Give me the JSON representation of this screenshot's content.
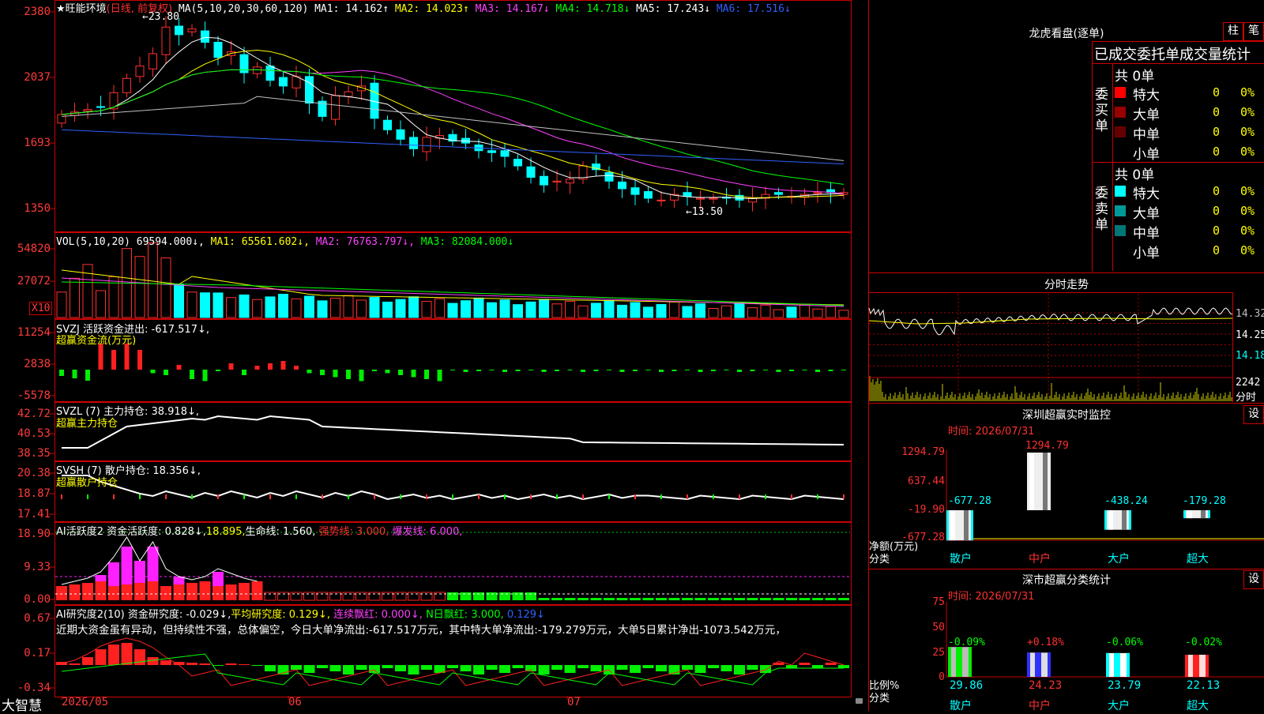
{
  "kline": {
    "title": "★旺能环境",
    "period": "(日线, 前复权)",
    "ma_label": "MA(5,10,20,30,60,120)",
    "ma1": "MA1: 14.162↑",
    "ma2": "MA2: 14.023↑",
    "ma3": "MA3: 14.167↓",
    "ma4": "MA4: 14.718↓",
    "ma5": "MA5: 17.243↓",
    "ma6": "MA6: 17.516↓",
    "y_labels": [
      "2380",
      "2037",
      "1693",
      "1350"
    ],
    "max_mark": "←23.80",
    "min_mark": "←13.50"
  },
  "vol": {
    "label": "VOL(5,10,20)",
    "value": "69594.000↓,",
    "ma1": "MA1: 65561.602↓,",
    "ma2": "MA2: 76763.797↓,",
    "ma3": "MA3: 82084.000↓",
    "y_labels": [
      "54820",
      "27072"
    ],
    "unit": "X10"
  },
  "svzj": {
    "label": "SVZJ  活跃资金进出: -617.517↓,",
    "sub": "超赢资金流(万元)",
    "y_labels": [
      "11254",
      "2838",
      "-5578"
    ]
  },
  "svzl": {
    "label": "SVZL (7) 主力持仓: 38.918↓,",
    "sub": "超赢主力持仓",
    "y_labels": [
      "42.72",
      "40.53",
      "38.35"
    ]
  },
  "svsh": {
    "label": "SVSH (7) 散户持仓: 18.356↓,",
    "sub": "超赢散户持仓",
    "y_labels": [
      "20.38",
      "18.87",
      "17.41"
    ]
  },
  "ai_active": {
    "label1": "AI活跃度2 资金活跃度: 0.828↓,",
    "value2": "18.895,",
    "label3": "生命线: 1.560,",
    "label4": "强势线: 3.000,",
    "label5": "爆发线: 6.000,",
    "y_labels": [
      "18.90",
      "9.33",
      "0.00"
    ]
  },
  "ai_research": {
    "label1": "AI研究度2(10) 资金研究度: -0.029↓,",
    "label2": "平均研究度: 0.129↓,",
    "label3": "连续飘红: 0.000↓,",
    "label4": "N日飘红: 3.000,",
    "label5": "0.129↓",
    "comment": "近期大资金虽有异动，但持续性不强，总体偏空，今日大单净流出:-617.517万元，其中特大单净流出:-179.279万元，大单5日累计净出-1073.542万元，",
    "y_labels": [
      "0.67",
      "0.17",
      "-0.34"
    ]
  },
  "xaxis": {
    "brand": "大智慧",
    "labels": [
      "2026/05",
      "06",
      "07"
    ]
  },
  "right": {
    "lhb_title": "龙虎看盘(逐单)",
    "btn1": "柱",
    "btn2": "笔",
    "table_title": "已成交委托单成交量统计",
    "buy_side_label": "委买单",
    "sell_side_label": "委卖单",
    "buy_total": "共 0单",
    "sell_total": "共 0单",
    "buy_rows": [
      {
        "name": "特大",
        "count": "0",
        "pct": "0%",
        "color": "#ff0000"
      },
      {
        "name": "大单",
        "count": "0",
        "pct": "0%",
        "color": "#990000"
      },
      {
        "name": "中单",
        "count": "0",
        "pct": "0%",
        "color": "#660000"
      },
      {
        "name": "小单",
        "count": "0",
        "pct": "0%",
        "color": ""
      }
    ],
    "sell_rows": [
      {
        "name": "特大",
        "count": "0",
        "pct": "0%",
        "color": "#00ffff"
      },
      {
        "name": "大单",
        "count": "0",
        "pct": "0%",
        "color": "#009999"
      },
      {
        "name": "中单",
        "count": "0",
        "pct": "0%",
        "color": "#007777"
      },
      {
        "name": "小单",
        "count": "0",
        "pct": "0%",
        "color": ""
      }
    ],
    "intraday_title": "分时走势",
    "intraday_prices": [
      "14.32",
      "14.25",
      "14.18"
    ],
    "intraday_vol": "2242",
    "intraday_unit": "分时",
    "monitor_title": "深圳超赢实时监控",
    "monitor_btn": "设",
    "monitor_time": "时间: 2026/07/31",
    "monitor_y": [
      "1294.79",
      "637.44",
      "-19.90",
      "-677.28"
    ],
    "monitor_y_title": "净额(万元)",
    "monitor_x_title": "分类",
    "monitor_categories": [
      "散户",
      "中户",
      "大户",
      "超大"
    ],
    "monitor_values": [
      "-677.28",
      "1294.79",
      "-438.24",
      "-179.28"
    ],
    "stats_title": "深市超赢分类统计",
    "stats_btn": "设",
    "stats_time": "时间: 2026/07/31",
    "stats_y": [
      "75",
      "50",
      "25",
      "0"
    ],
    "stats_y_title": "比例%",
    "stats_x_title": "分类",
    "stats_changes": [
      "-0.09%",
      "+0.18%",
      "-0.06%",
      "-0.02%"
    ],
    "stats_values": [
      "29.86",
      "24.23",
      "23.79",
      "22.13"
    ]
  },
  "colors": {
    "up": "#ff3030",
    "down": "#00ffff",
    "frame": "#cc0000",
    "ma1": "#ffffff",
    "ma2": "#ffff00",
    "ma3": "#ff40ff",
    "ma4": "#00ff00",
    "ma5": "#c0c0c0",
    "ma6": "#3060ff"
  }
}
